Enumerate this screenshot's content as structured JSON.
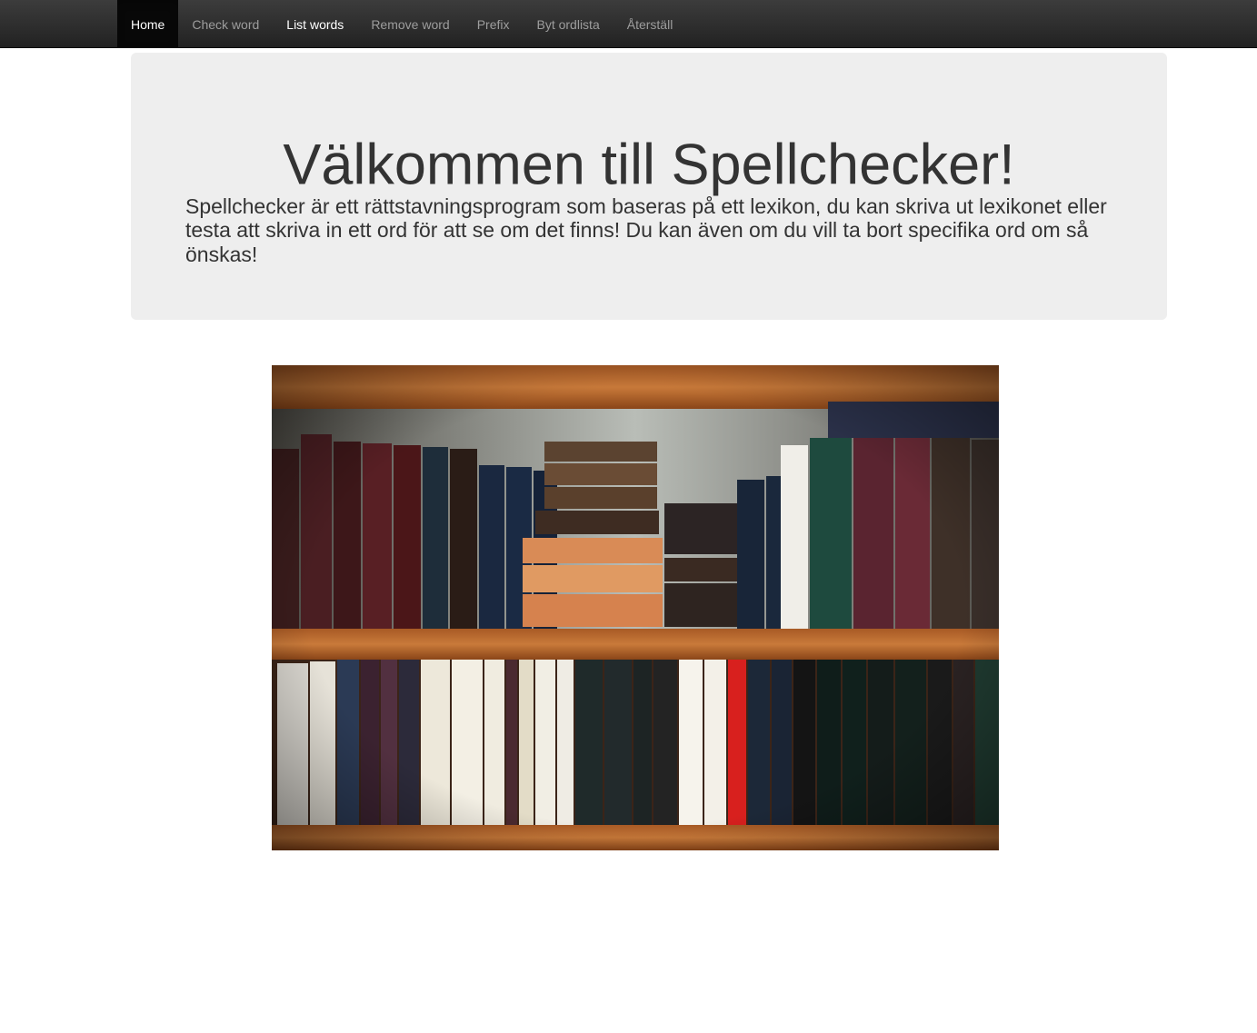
{
  "nav": {
    "items": [
      {
        "label": "Home"
      },
      {
        "label": "Check word"
      },
      {
        "label": "List words"
      },
      {
        "label": "Remove word"
      },
      {
        "label": "Prefix"
      },
      {
        "label": "Byt ordlista"
      },
      {
        "label": "Återställ"
      }
    ]
  },
  "jumbotron": {
    "title": "Välkommen till Spellchecker!",
    "text": "Spellchecker är ett rättstavningsprogram som baseras på ett lexikon, du kan skriva ut lexikonet eller testa att skriva in ett ord för att se om det finns! Du kan även om du vill ta bort specifika ord om så önskas!"
  }
}
